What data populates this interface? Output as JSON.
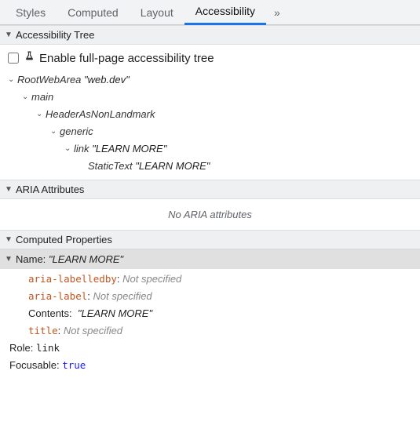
{
  "tabs": {
    "styles": "Styles",
    "computed": "Computed",
    "layout": "Layout",
    "accessibility": "Accessibility",
    "overflow": "»"
  },
  "sections": {
    "tree_header": "Accessibility Tree",
    "aria_header": "ARIA Attributes",
    "computed_header": "Computed Properties"
  },
  "enable_row": {
    "label": "Enable full-page accessibility tree"
  },
  "tree": {
    "n0_role": "RootWebArea",
    "n0_name": "\"web.dev\"",
    "n1_role": "main",
    "n2_role": "HeaderAsNonLandmark",
    "n3_role": "generic",
    "n4_role": "link",
    "n4_name": "\"LEARN MORE\"",
    "n5_role": "StaticText",
    "n5_name": "\"LEARN MORE\""
  },
  "aria_empty": "No ARIA attributes",
  "computed": {
    "name_label": "Name:",
    "name_value": "\"LEARN MORE\"",
    "aria_labelledby_k": "aria-labelledby",
    "aria_labelledby_v": "Not specified",
    "aria_label_k": "aria-label",
    "aria_label_v": "Not specified",
    "contents_k": "Contents:",
    "contents_v": "\"LEARN MORE\"",
    "title_k": "title",
    "title_v": "Not specified",
    "role_k": "Role:",
    "role_v": "link",
    "focusable_k": "Focusable:",
    "focusable_v": "true"
  }
}
